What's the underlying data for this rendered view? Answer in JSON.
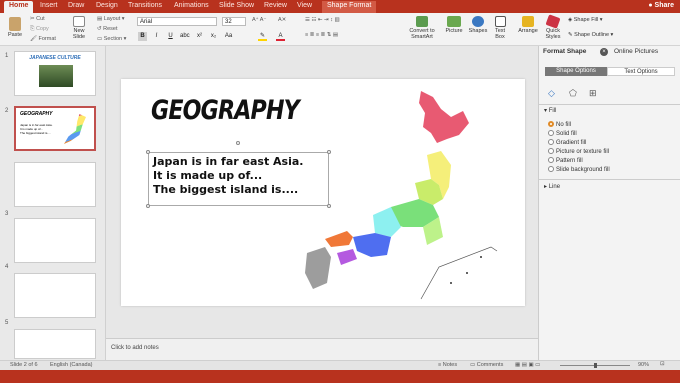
{
  "tabs": [
    "Home",
    "Insert",
    "Draw",
    "Design",
    "Transitions",
    "Animations",
    "Slide Show",
    "Review",
    "View",
    "Shape Format"
  ],
  "share": "Share",
  "ribbon": {
    "paste": "Paste",
    "cut": "Cut",
    "copy": "Copy",
    "format": "Format",
    "new_slide": "New\nSlide",
    "layout": "Layout",
    "reset": "Reset",
    "section": "Section",
    "font": "Arial",
    "size": "32",
    "convert": "Convert to\nSmartArt",
    "picture": "Picture",
    "shapes": "Shapes",
    "textbox": "Text\nBox",
    "arrange": "Arrange",
    "quick_styles": "Quick\nStyles",
    "shape_fill": "Shape Fill",
    "shape_outline": "Shape Outline"
  },
  "thumbs": [
    {
      "num": "1",
      "title": "JAPANESE CULTURE"
    },
    {
      "num": "2",
      "title": "GEOGRAPHY",
      "lines": [
        "Japan is in far east Asia.",
        "It is made up of...",
        "The biggest island is...."
      ]
    },
    {
      "num": "3"
    },
    {
      "num": "4"
    },
    {
      "num": "5"
    },
    {
      "num": "6"
    }
  ],
  "slide": {
    "title": "GEOGRAPHY",
    "lines": [
      "Japan is in far east Asia.",
      "It is made up of...",
      "The biggest island is...."
    ]
  },
  "notes": "Click to add notes",
  "pane": {
    "tab1": "Format Shape",
    "tab2": "Online Pictures",
    "seg1": "Shape Options",
    "seg2": "Text Options",
    "fill": "Fill",
    "options": [
      "No fill",
      "Solid fill",
      "Gradient fill",
      "Picture or texture fill",
      "Pattern fill",
      "Slide background fill"
    ],
    "line": "Line"
  },
  "status": {
    "slide": "Slide 2 of 6",
    "lang": "English (Canada)",
    "notes": "Notes",
    "comments": "Comments",
    "zoom": "90%"
  }
}
